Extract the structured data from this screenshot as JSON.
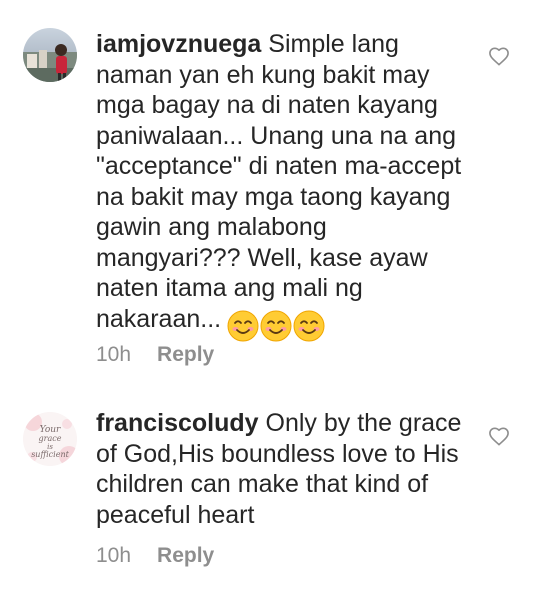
{
  "comments": [
    {
      "username": "iamjovznuega",
      "text": "Simple lang naman yan eh kung bakit may mga bagay na di naten kayang paniwalaan... Unang una na ang \"acceptance\" di naten ma-accept na bakit may mga taong kayang gawin ang malabong mangyari??? Well, kase ayaw naten itama ang mali ng nakaraan...",
      "emojis": [
        "smiling-face-emoji",
        "smiling-face-emoji",
        "smiling-face-emoji"
      ],
      "time": "10h",
      "reply_label": "Reply",
      "like_icon": "heart-outline-icon"
    },
    {
      "username": "franciscoludy",
      "text": "Only by the grace of God,His boundless love to His children can make that kind of peaceful heart",
      "avatar_text": "Your grace is sufficient",
      "time": "10h",
      "reply_label": "Reply",
      "like_icon": "heart-outline-icon"
    }
  ],
  "colors": {
    "text": "#262626",
    "secondary": "#8e8e8e",
    "emoji_face": "#ffcc33",
    "emoji_cheek": "#ff9aa2"
  }
}
